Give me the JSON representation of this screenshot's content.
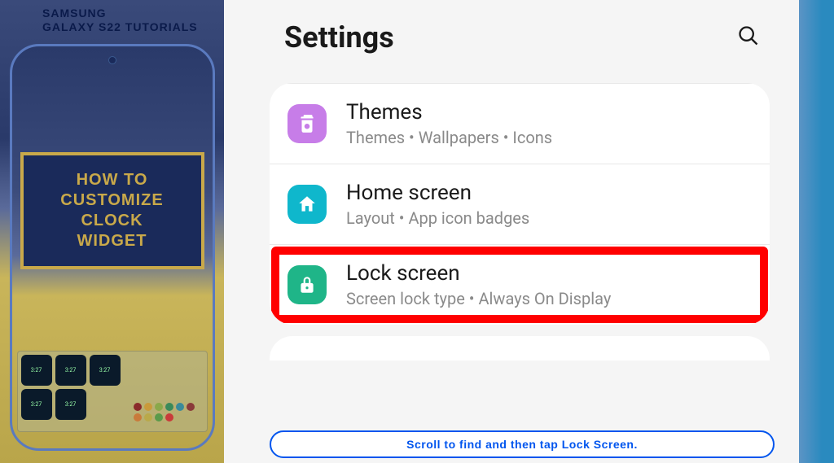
{
  "sidebar": {
    "brand_line1": "SAMSUNG",
    "brand_line2": "GALAXY S22 TUTORIALS",
    "tutorial_title": {
      "line1": "HOW TO",
      "line2": "CUSTOMIZE",
      "line3": "CLOCK",
      "line4": "WIDGET"
    },
    "widget_times": [
      "3:27",
      "3:27",
      "3:27",
      "3:27",
      "3:27"
    ],
    "color_dots": [
      "#8a2a2a",
      "#c99a3a",
      "#8aa84a",
      "#3a8a5a",
      "#3a8a9a",
      "#8a3a3a",
      "#c97a3a",
      "#b9a94a",
      "#5a9a4a",
      "#c93a3a"
    ]
  },
  "settings": {
    "title": "Settings",
    "items": [
      {
        "title": "Themes",
        "subtitle": "Themes  •  Wallpapers  •  Icons"
      },
      {
        "title": "Home screen",
        "subtitle": "Layout  •  App icon badges"
      },
      {
        "title": "Lock screen",
        "subtitle": "Screen lock type  •  Always On Display"
      }
    ]
  },
  "instruction": "Scroll to find and then tap Lock Screen."
}
